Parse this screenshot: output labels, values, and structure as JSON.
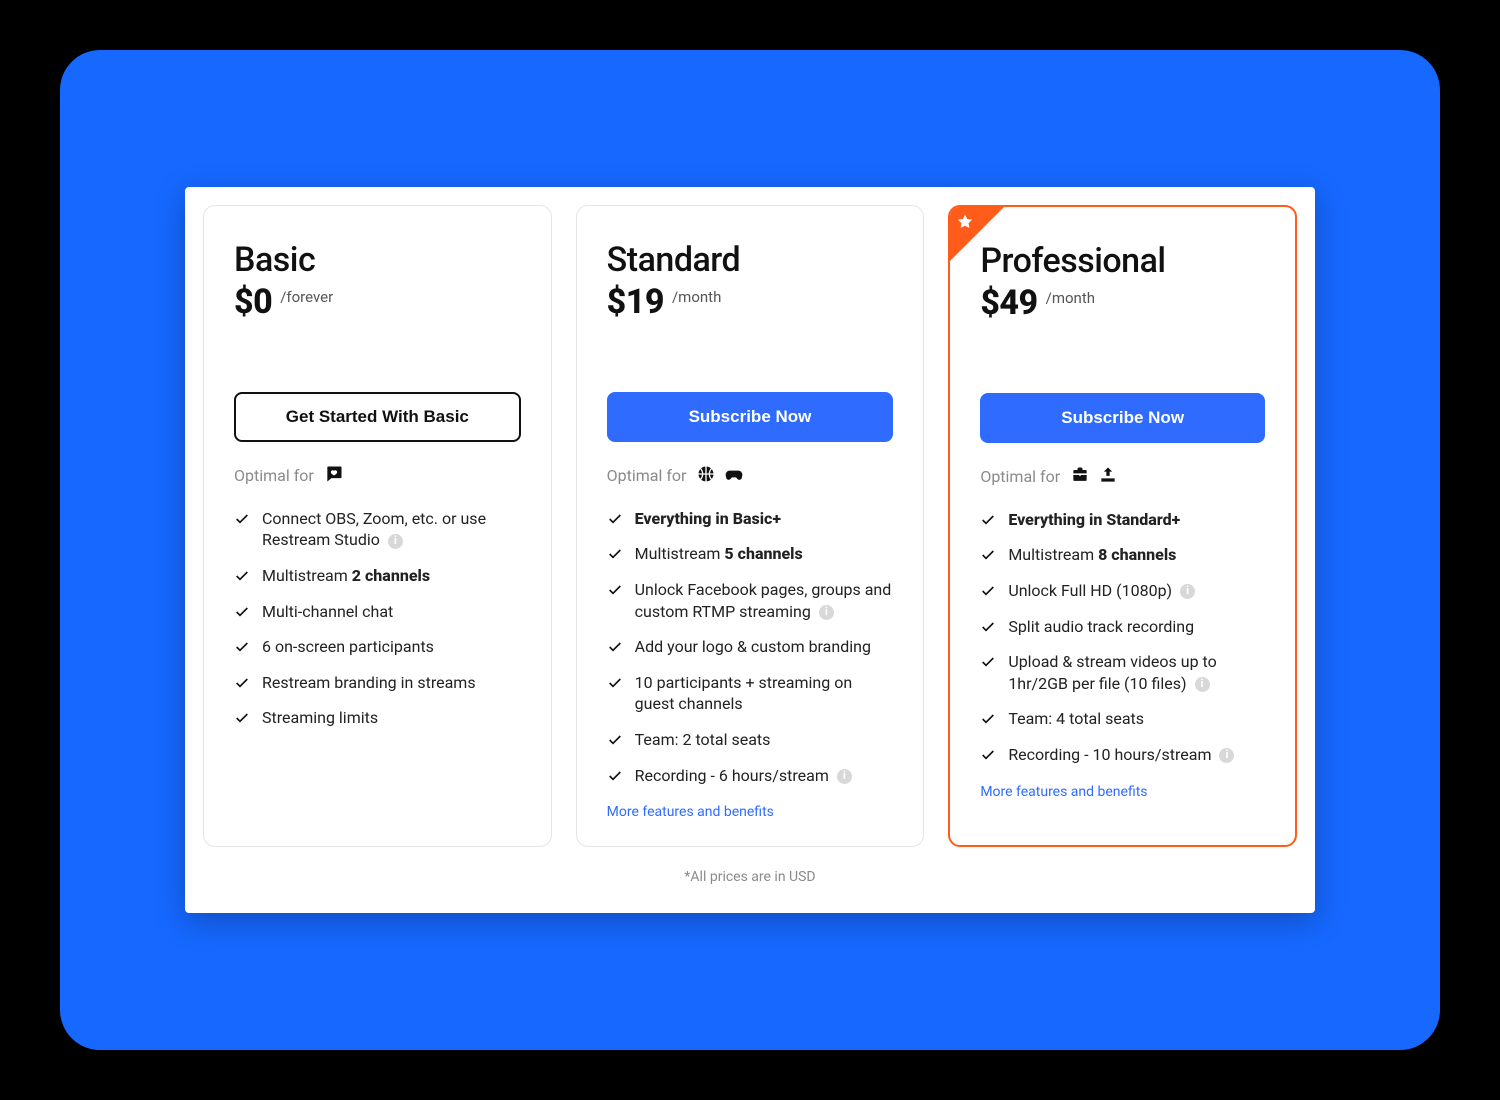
{
  "footnote": "*All prices are in USD",
  "more_link": "More features and benefits",
  "optimal_label": "Optimal for",
  "plans": [
    {
      "name": "Basic",
      "price": "$0",
      "period": "/forever",
      "cta": "Get Started With Basic",
      "features": [
        {
          "pre": "Connect OBS, Zoom, etc. or use Restream Studio",
          "bold": "",
          "post": "",
          "info": true
        },
        {
          "pre": "Multistream ",
          "bold": "2 channels",
          "post": "",
          "info": false
        },
        {
          "pre": "Multi-channel chat",
          "bold": "",
          "post": "",
          "info": false
        },
        {
          "pre": "6 on-screen participants",
          "bold": "",
          "post": "",
          "info": false
        },
        {
          "pre": "Restream branding in streams",
          "bold": "",
          "post": "",
          "info": false
        },
        {
          "pre": "Streaming limits",
          "bold": "",
          "post": "",
          "info": false
        }
      ]
    },
    {
      "name": "Standard",
      "price": "$19",
      "period": "/month",
      "cta": "Subscribe Now",
      "features": [
        {
          "pre": "",
          "bold": "Everything in Basic+",
          "post": "",
          "info": false
        },
        {
          "pre": "Multistream ",
          "bold": "5 channels",
          "post": "",
          "info": false
        },
        {
          "pre": "Unlock Facebook pages, groups and custom RTMP streaming",
          "bold": "",
          "post": "",
          "info": true
        },
        {
          "pre": "Add your logo & custom branding",
          "bold": "",
          "post": "",
          "info": false
        },
        {
          "pre": "10 participants + streaming on guest channels",
          "bold": "",
          "post": "",
          "info": false
        },
        {
          "pre": "Team: 2 total seats",
          "bold": "",
          "post": "",
          "info": false
        },
        {
          "pre": "Recording - 6 hours/stream",
          "bold": "",
          "post": "",
          "info": true
        }
      ]
    },
    {
      "name": "Professional",
      "price": "$49",
      "period": "/month",
      "cta": "Subscribe Now",
      "features": [
        {
          "pre": "",
          "bold": "Everything in Standard+",
          "post": "",
          "info": false
        },
        {
          "pre": "Multistream ",
          "bold": "8 channels",
          "post": "",
          "info": false
        },
        {
          "pre": "Unlock Full HD (1080p)",
          "bold": "",
          "post": "",
          "info": true
        },
        {
          "pre": "Split audio track recording",
          "bold": "",
          "post": "",
          "info": false
        },
        {
          "pre": "Upload & stream videos up to 1hr/2GB per file (10 files)",
          "bold": "",
          "post": "",
          "info": true
        },
        {
          "pre": "Team: 4 total seats",
          "bold": "",
          "post": "",
          "info": false
        },
        {
          "pre": "Recording - 10 hours/stream",
          "bold": "",
          "post": "",
          "info": true
        }
      ]
    }
  ]
}
